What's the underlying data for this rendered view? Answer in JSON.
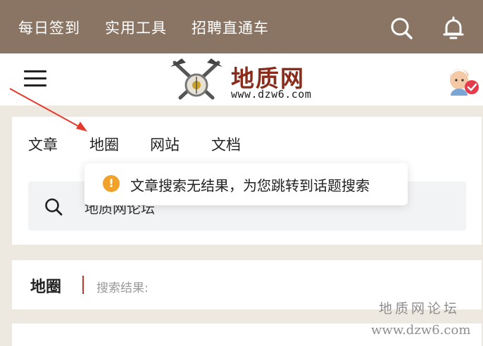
{
  "topbar": {
    "links": [
      "每日签到",
      "实用工具",
      "招聘直通车"
    ],
    "search_icon": "search-icon",
    "bell_icon": "bell-icon",
    "bg_color": "#8a7564"
  },
  "header": {
    "logo_title": "地质网",
    "logo_url": "www.dzw6.com",
    "menu_icon": "hamburger-icon",
    "avatar_icon": "user-avatar-with-badge"
  },
  "search": {
    "tabs": [
      "文章",
      "地圈",
      "网站",
      "文档"
    ],
    "query": "地质网论坛"
  },
  "toast": {
    "message": "文章搜索无结果，为您跳转到话题搜索",
    "icon": "warning-icon",
    "icon_color": "#f0a22a"
  },
  "results": {
    "title": "地圈",
    "subtitle": "搜索结果:",
    "accent_color": "#c0392b"
  },
  "watermark": {
    "line1": "地质网论坛",
    "line2": "www.dzw6.com"
  },
  "annotation": {
    "arrow_color": "#e53b2c"
  }
}
